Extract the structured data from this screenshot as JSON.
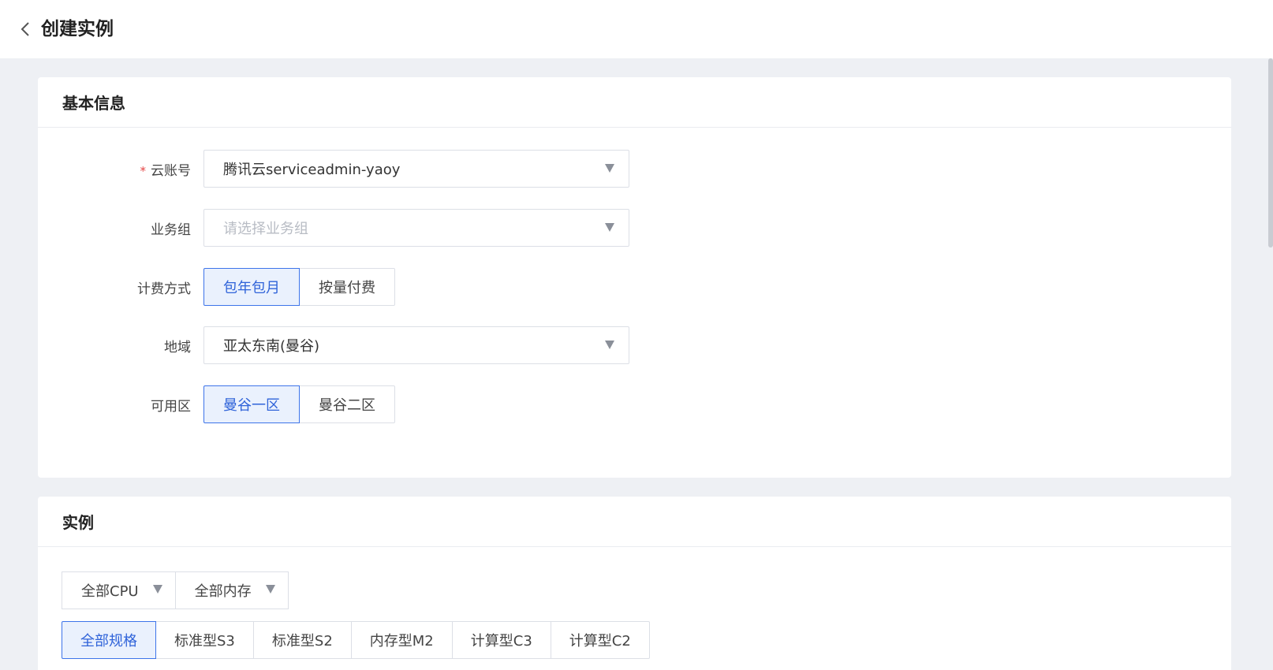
{
  "header": {
    "title": "创建实例",
    "back_icon": "chevron-left-icon"
  },
  "basic": {
    "section_title": "基本信息",
    "cloud_account": {
      "label": "云账号",
      "required_mark": "*",
      "value": "腾讯云serviceadmin-yaoy"
    },
    "business_group": {
      "label": "业务组",
      "placeholder": "请选择业务组"
    },
    "billing": {
      "label": "计费方式",
      "options": [
        "包年包月",
        "按量付费"
      ],
      "selected": "包年包月"
    },
    "region": {
      "label": "地域",
      "value": "亚太东南(曼谷)"
    },
    "zone": {
      "label": "可用区",
      "options": [
        "曼谷一区",
        "曼谷二区"
      ],
      "selected": "曼谷一区"
    }
  },
  "instance": {
    "section_title": "实例",
    "filters": {
      "cpu": "全部CPU",
      "memory": "全部内存"
    },
    "spec_tabs": [
      "全部规格",
      "标准型S3",
      "标准型S2",
      "内存型M2",
      "计算型C3",
      "计算型C2"
    ],
    "spec_selected": "全部规格"
  },
  "colors": {
    "accent": "#3d74ea",
    "accent_bg": "#eaf1fd",
    "required": "#e54545",
    "page_bg": "#eef0f4"
  }
}
